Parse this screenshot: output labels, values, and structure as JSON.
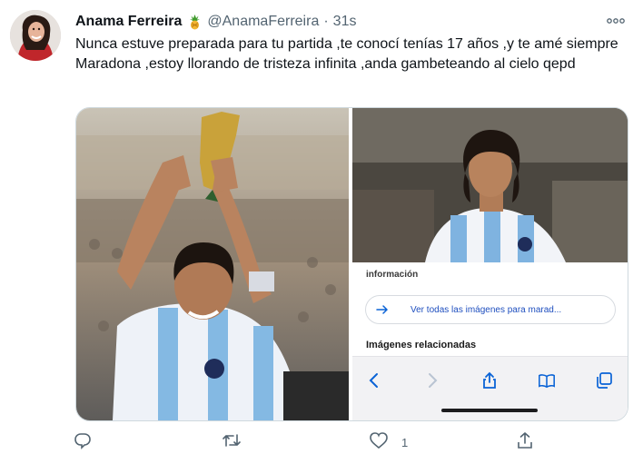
{
  "tweet": {
    "author_name": "Anama Ferreira",
    "emoji": "pineapple-emoji",
    "handle": "@AnamaFerreira",
    "separator": "·",
    "time": "31s",
    "text": "Nunca estuve preparada para tu partida ,te conocí tenías 17 años ,y te amé siempre Maradona ,estoy llorando de tristeza infinita ,anda gambeteando al cielo qepd"
  },
  "media": {
    "right_panel": {
      "info_label": "información",
      "view_all_label": "Ver todas las imágenes para marad...",
      "related_label": "Imágenes relacionadas"
    }
  },
  "actions": {
    "reply_count": "",
    "retweet_count": "",
    "like_count": "1",
    "share_count": ""
  },
  "colors": {
    "text_primary": "#0f1419",
    "text_secondary": "#536471",
    "border": "#cfd9de",
    "link_blue": "#1f4fbf",
    "ios_blue": "#0a63d6"
  }
}
